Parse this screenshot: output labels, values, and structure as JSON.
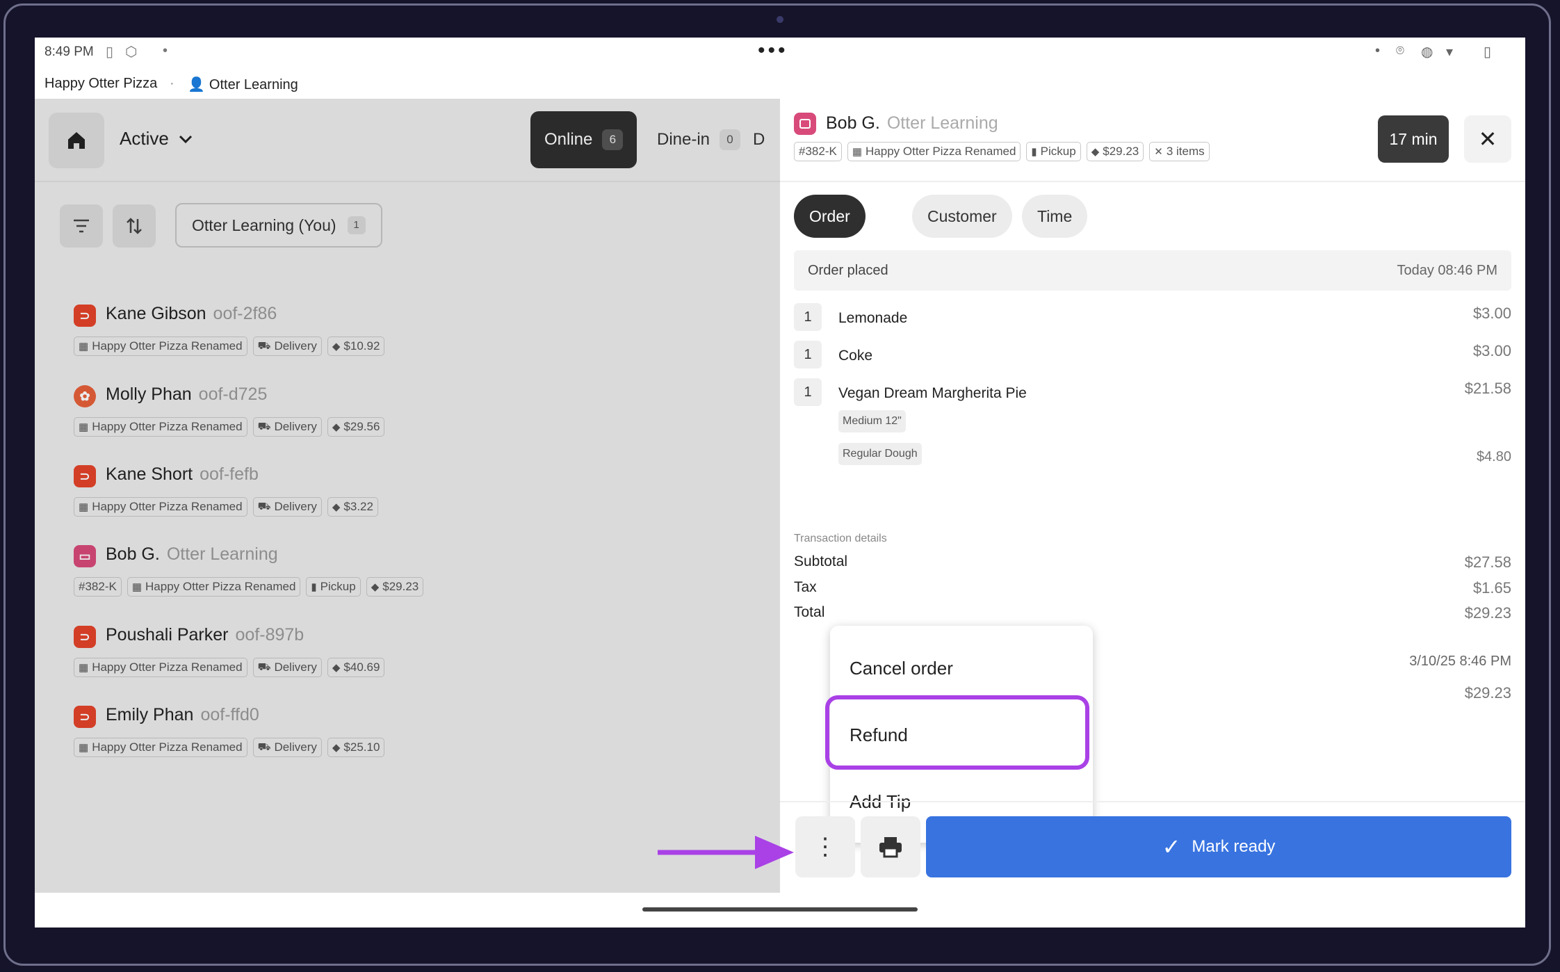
{
  "status": {
    "time": "8:49 PM",
    "dots": "•••"
  },
  "account": {
    "restaurant": "Happy Otter Pizza",
    "separator": "·",
    "user": "Otter Learning"
  },
  "left": {
    "status_filter": "Active",
    "channels": [
      {
        "label": "Online",
        "count": "6"
      },
      {
        "label": "Dine-in",
        "count": "0"
      },
      {
        "label": "D"
      }
    ],
    "staff_filter": {
      "label": "Otter Learning (You)",
      "count": "1"
    },
    "orders": [
      {
        "name": "Kane Gibson",
        "id": "oof-2f86",
        "tags": [
          "Happy Otter Pizza Renamed",
          "Delivery",
          "$10.92"
        ]
      },
      {
        "name": "Molly Phan",
        "id": "oof-d725",
        "tags": [
          "Happy Otter Pizza Renamed",
          "Delivery",
          "$29.56"
        ]
      },
      {
        "name": "Kane Short",
        "id": "oof-fefb",
        "tags": [
          "Happy Otter Pizza Renamed",
          "Delivery",
          "$3.22"
        ]
      },
      {
        "name": "Bob G.",
        "id": "Otter Learning",
        "tags": [
          "#382-K",
          "Happy Otter Pizza Renamed",
          "Pickup",
          "$29.23"
        ]
      },
      {
        "name": "Poushali Parker",
        "id": "oof-897b",
        "tags": [
          "Happy Otter Pizza Renamed",
          "Delivery",
          "$40.69"
        ]
      },
      {
        "name": "Emily Phan",
        "id": "oof-ffd0",
        "tags": [
          "Happy Otter Pizza Renamed",
          "Delivery",
          "$25.10"
        ]
      }
    ]
  },
  "detail": {
    "name": "Bob G.",
    "subtitle": "Otter Learning",
    "tags": [
      "#382-K",
      "Happy Otter Pizza Renamed",
      "Pickup",
      "$29.23",
      "3 items"
    ],
    "timer": "17 min",
    "tabs": [
      "Order",
      "Customer",
      "Time"
    ],
    "placed_label": "Order placed",
    "placed_time": "Today 08:46 PM",
    "items": [
      {
        "qty": "1",
        "name": "Lemonade",
        "price": "$3.00"
      },
      {
        "qty": "1",
        "name": "Coke",
        "price": "$3.00"
      },
      {
        "qty": "1",
        "name": "Vegan Dream Margherita Pie",
        "price": "$21.58"
      }
    ],
    "modifiers": [
      {
        "name": "Medium 12\"",
        "price": "$4.80"
      },
      {
        "name": "Regular Dough"
      }
    ],
    "tx_title": "Transaction details",
    "subtotal": {
      "label": "Subtotal",
      "value": "$27.58"
    },
    "tax": {
      "label": "Tax",
      "value": "$1.65"
    },
    "total": {
      "label": "Total",
      "value": "$29.23"
    },
    "payment_time": "3/10/25 8:46 PM",
    "payment_amount": "$29.23"
  },
  "menu": {
    "cancel": "Cancel order",
    "refund": "Refund",
    "tip": "Add Tip"
  },
  "actions": {
    "mark_ready": "Mark ready"
  },
  "colors": {
    "primary": "#3873e0",
    "highlight": "#a941e6",
    "doordash": "#e5442a",
    "brand_pink": "#d84a7a"
  }
}
